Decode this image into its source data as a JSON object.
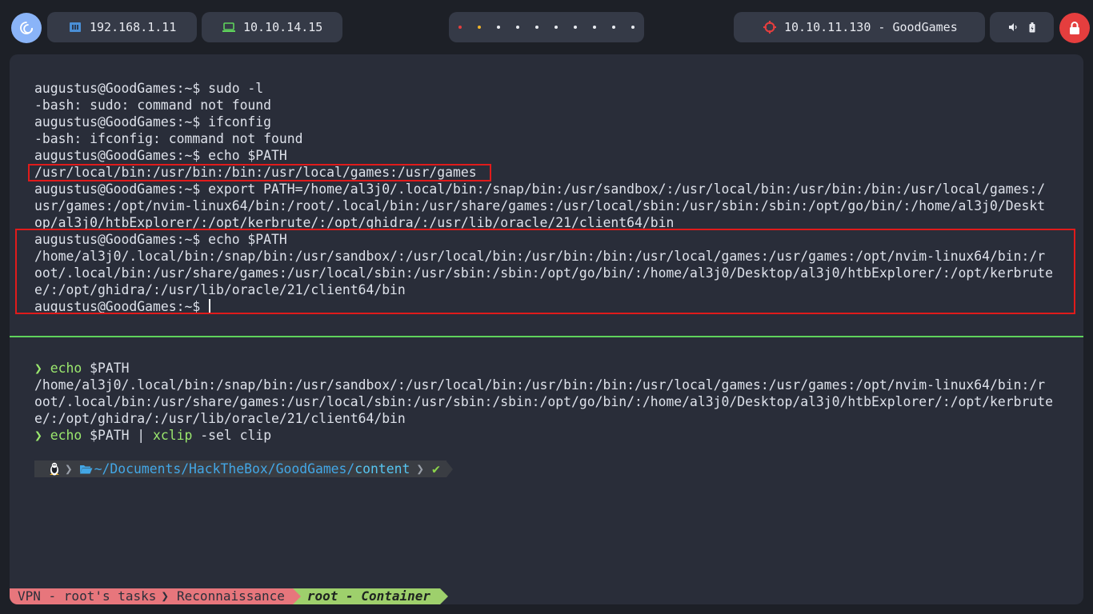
{
  "topbar": {
    "local_ip": "192.168.1.11",
    "vpn_ip": "10.10.14.15",
    "target": "10.10.11.130 - GoodGames",
    "workspace_count": 10
  },
  "colors": {
    "bg": "#1d2027",
    "pill": "#353a47",
    "terminal_bg": "#292d39",
    "highlight_red": "#e01b1b",
    "divider_green": "#5fd35c",
    "power_button_red": "#e53e3e"
  },
  "icons": {
    "launcher": "debian-swirl-icon",
    "local_ip": "network-icon",
    "vpn_ip": "laptop-icon",
    "target": "crosshair-icon",
    "volume": "speaker-icon",
    "battery": "battery-icon",
    "power": "lock-icon"
  },
  "upper_pane": {
    "lines": [
      "augustus@GoodGames:~$ sudo -l",
      "-bash: sudo: command not found",
      "augustus@GoodGames:~$ ifconfig",
      "-bash: ifconfig: command not found",
      "augustus@GoodGames:~$ echo $PATH",
      "/usr/local/bin:/usr/bin:/bin:/usr/local/games:/usr/games",
      "augustus@GoodGames:~$ export PATH=/home/al3j0/.local/bin:/snap/bin:/usr/sandbox/:/usr/local/bin:/usr/bin:/bin:/usr/local/games:/",
      "usr/games:/opt/nvim-linux64/bin:/root/.local/bin:/usr/share/games:/usr/local/sbin:/usr/sbin:/sbin:/opt/go/bin/:/home/al3j0/Deskt",
      "op/al3j0/htbExplorer/:/opt/kerbrute/:/opt/ghidra/:/usr/lib/oracle/21/client64/bin",
      "augustus@GoodGames:~$ echo $PATH",
      "/home/al3j0/.local/bin:/snap/bin:/usr/sandbox/:/usr/local/bin:/usr/bin:/bin:/usr/local/games:/usr/games:/opt/nvim-linux64/bin:/r",
      "oot/.local/bin:/usr/share/games:/usr/local/sbin:/usr/sbin:/sbin:/opt/go/bin/:/home/al3j0/Desktop/al3j0/htbExplorer/:/opt/kerbrute",
      "e/:/opt/ghidra/:/usr/lib/oracle/21/client64/bin"
    ],
    "last_prompt": "augustus@GoodGames:~$ "
  },
  "lower_pane": {
    "prompt_glyph": "❯",
    "cmd1": "echo",
    "cmd1_args": " $PATH",
    "output": [
      "/home/al3j0/.local/bin:/snap/bin:/usr/sandbox/:/usr/local/bin:/usr/bin:/bin:/usr/local/games:/usr/games:/opt/nvim-linux64/bin:/r",
      "oot/.local/bin:/usr/share/games:/usr/local/sbin:/usr/sbin:/sbin:/opt/go/bin/:/home/al3j0/Desktop/al3j0/htbExplorer/:/opt/kerbrute",
      "e/:/opt/ghidra/:/usr/lib/oracle/21/client64/bin"
    ],
    "cmd2": "echo",
    "cmd2_mid": " $PATH | ",
    "cmd2_tool": "xclip",
    "cmd2_args": " -sel clip",
    "powerline": {
      "os_icon": "linux-penguin-icon",
      "folder_icon": "folder-open-icon",
      "path_prefix": "~/Documents/HackTheBox/GoodGames/",
      "path_current": "content",
      "status_icon": "✔"
    }
  },
  "tmux_status": {
    "session": "VPN - root's tasks",
    "window1": "Reconnaissance",
    "window2": "root - Container"
  }
}
